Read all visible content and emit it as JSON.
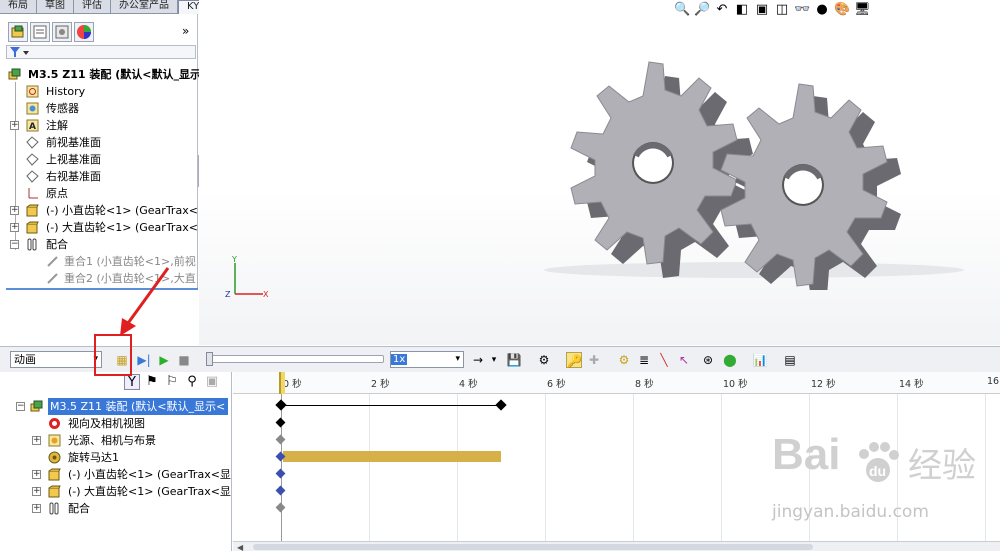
{
  "top_tabs": [
    "布局",
    "草图",
    "评估",
    "办公室产品",
    "KYTool"
  ],
  "feature_tree": {
    "root": "M3.5 Z11 装配  (默认<默认_显示",
    "items": [
      {
        "label": "History",
        "icon": "history-icon"
      },
      {
        "label": "传感器",
        "icon": "sensor-icon"
      },
      {
        "label": "注解",
        "icon": "annotation-icon"
      },
      {
        "label": "前视基准面",
        "icon": "plane-icon"
      },
      {
        "label": "上视基准面",
        "icon": "plane-icon"
      },
      {
        "label": "右视基准面",
        "icon": "plane-icon"
      },
      {
        "label": "原点",
        "icon": "origin-icon"
      },
      {
        "label": "(-) 小直齿轮<1> (GearTrax<",
        "icon": "part-icon"
      },
      {
        "label": "(-) 大直齿轮<1> (GearTrax<",
        "icon": "part-icon"
      },
      {
        "label": "配合",
        "icon": "mates-icon"
      },
      {
        "label": "重合1 (小直齿轮<1>,前视",
        "icon": "mate-icon"
      },
      {
        "label": "重合2 (小直齿轮<1>,大直",
        "icon": "mate-icon"
      }
    ]
  },
  "motion": {
    "study_type": "动画",
    "speed": "1x",
    "tree_root": "M3.5 Z11 装配  (默认<默认_显示<",
    "tree_items": [
      {
        "label": "视向及相机视图"
      },
      {
        "label": "光源、相机与布景"
      },
      {
        "label": "旋转马达1"
      },
      {
        "label": "(-) 小直齿轮<1> (GearTrax<显"
      },
      {
        "label": "(-) 大直齿轮<1> (GearTrax<显"
      },
      {
        "label": "配合"
      }
    ],
    "ticks": [
      "0 秒",
      "2 秒",
      "4 秒",
      "6 秒",
      "8 秒",
      "10 秒",
      "12 秒",
      "14 秒",
      "16"
    ]
  },
  "watermark": {
    "brand": "Bai",
    "brand2": "经验",
    "url": "jingyan.baidu.com"
  },
  "colors": {
    "accent": "#3a78d8",
    "motor_bar": "#d6b14a",
    "highlight_box": "#e02020",
    "gear": "#b0b0b6"
  }
}
